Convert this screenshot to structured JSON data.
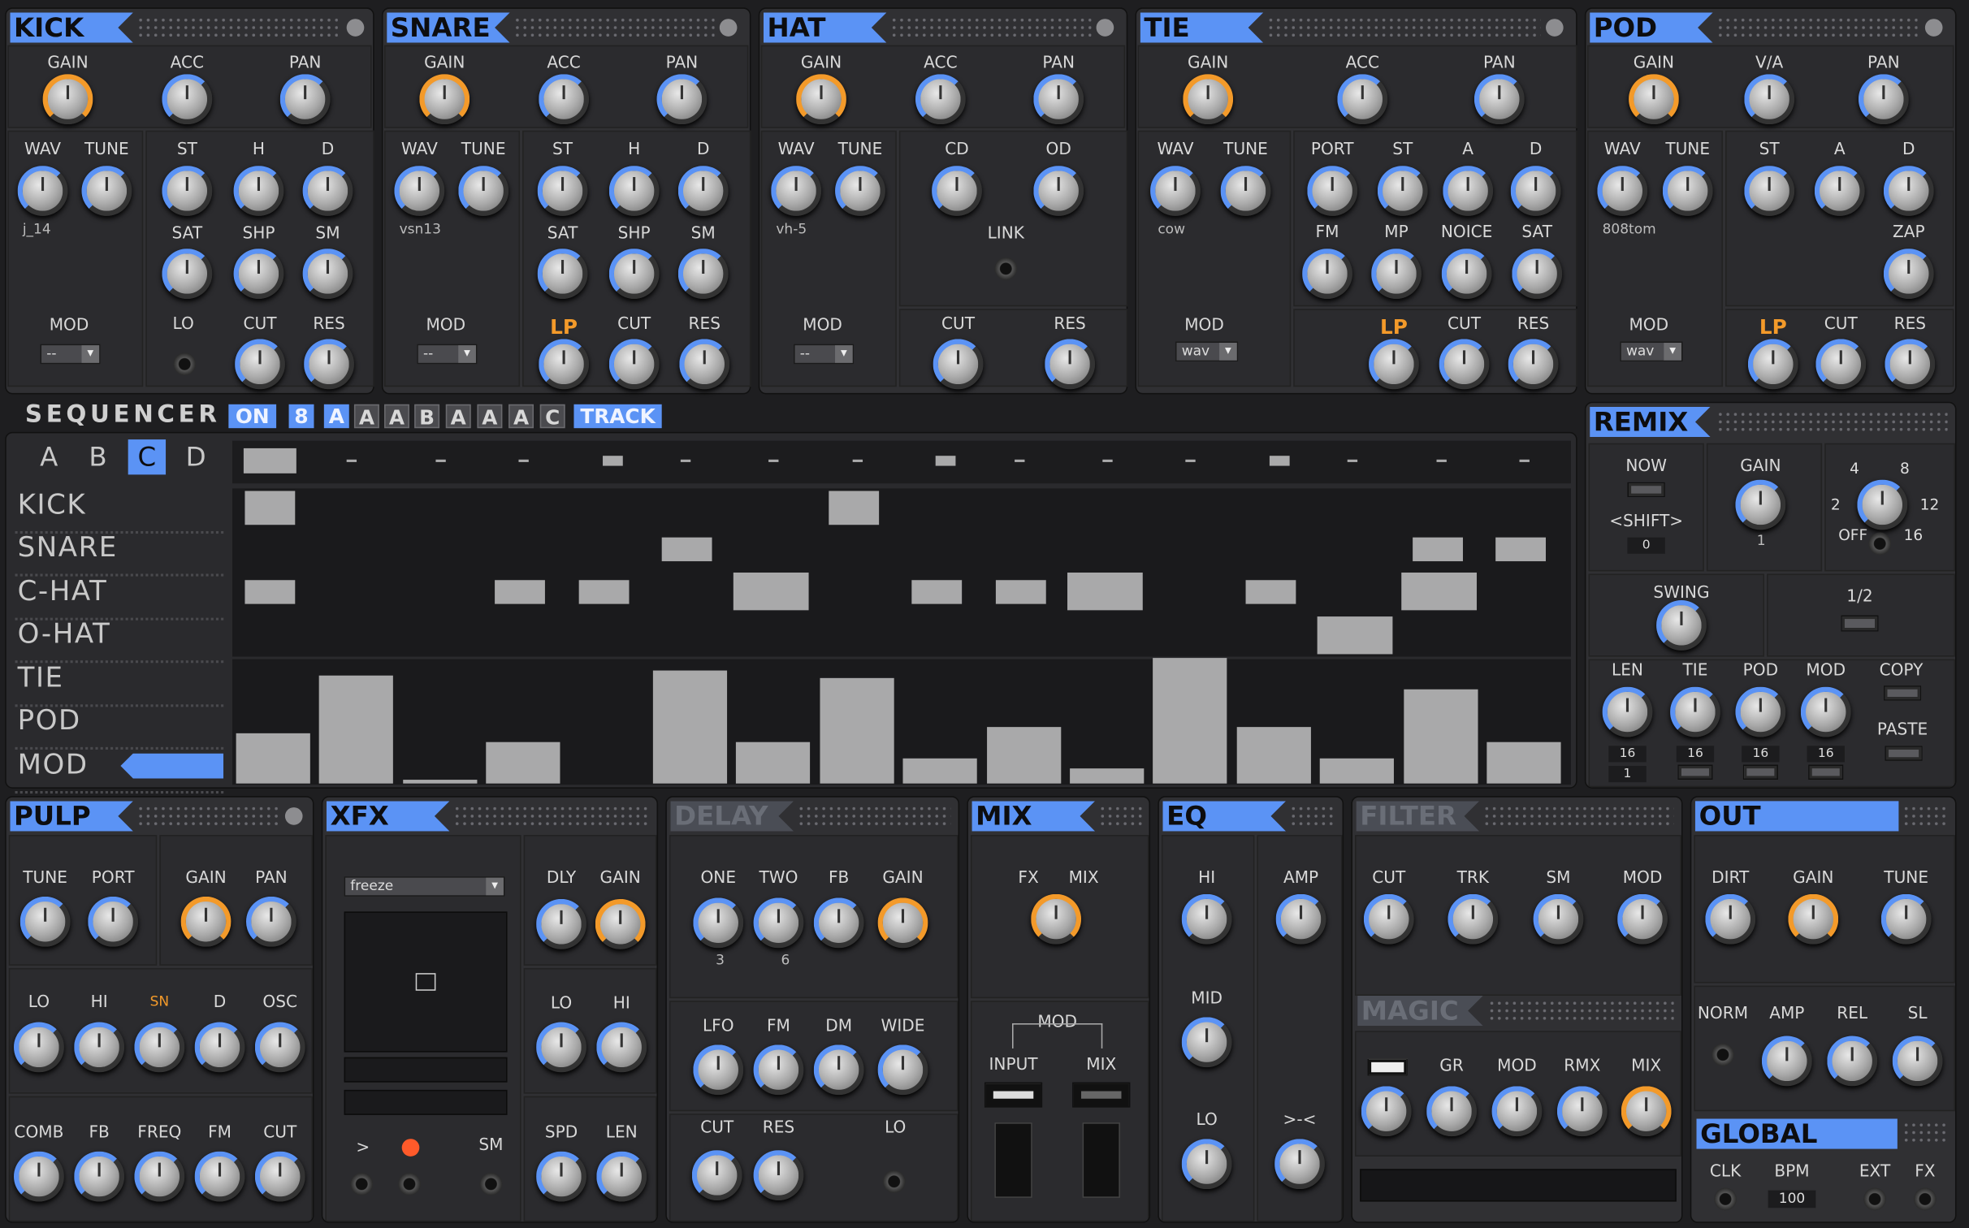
{
  "kick": {
    "title": "KICK",
    "row1": [
      "GAIN",
      "ACC",
      "PAN"
    ],
    "row2": [
      "WAV",
      "TUNE",
      "ST",
      "H",
      "D"
    ],
    "row3": [
      "SAT",
      "SHP",
      "SM"
    ],
    "wav": "j_14",
    "mod": "MOD",
    "mod_value": "--",
    "filter": [
      "LO",
      "CUT",
      "RES"
    ]
  },
  "snare": {
    "title": "SNARE",
    "row1": [
      "GAIN",
      "ACC",
      "PAN"
    ],
    "row2": [
      "WAV",
      "TUNE",
      "ST",
      "H",
      "D"
    ],
    "row3": [
      "SAT",
      "SHP",
      "SM"
    ],
    "wav": "vsn13",
    "mod": "MOD",
    "mod_value": "--",
    "filter": [
      "LP",
      "CUT",
      "RES"
    ]
  },
  "hat": {
    "title": "HAT",
    "row1": [
      "GAIN",
      "ACC",
      "PAN"
    ],
    "row2": [
      "WAV",
      "TUNE",
      "CD",
      "OD"
    ],
    "link": "LINK",
    "wav": "vh-5",
    "mod": "MOD",
    "mod_value": "--",
    "filter": [
      "CUT",
      "RES"
    ]
  },
  "tie": {
    "title": "TIE",
    "row1": [
      "GAIN",
      "ACC",
      "PAN"
    ],
    "row2": [
      "WAV",
      "TUNE",
      "PORT",
      "ST",
      "A",
      "D"
    ],
    "row3": [
      "FM",
      "MP",
      "NOICE",
      "SAT"
    ],
    "wav": "cow",
    "mod": "MOD",
    "mod_value": "wav",
    "filter": [
      "LP",
      "CUT",
      "RES"
    ]
  },
  "pod": {
    "title": "POD",
    "row1": [
      "GAIN",
      "V/A",
      "PAN"
    ],
    "row2": [
      "WAV",
      "TUNE",
      "ST",
      "A",
      "D"
    ],
    "zap": "ZAP",
    "wav": "808tom",
    "mod": "MOD",
    "mod_value": "wav",
    "filter": [
      "LP",
      "CUT",
      "RES"
    ]
  },
  "sequencer": {
    "title": "SEQUENCER",
    "chips": [
      "ON",
      "8",
      "A",
      "A",
      "A",
      "B",
      "A",
      "A",
      "A",
      "C",
      "TRACK"
    ],
    "patterns": [
      "A",
      "B",
      "C",
      "D"
    ],
    "rows": [
      "KICK",
      "SNARE",
      "C-HAT",
      "O-HAT",
      "TIE",
      "POD",
      "MOD"
    ],
    "kick_steps": [
      1,
      0,
      0,
      0,
      0,
      0,
      0,
      1,
      0,
      0,
      0,
      0,
      0,
      0,
      0,
      0
    ],
    "snare_steps": [
      0,
      0,
      0,
      0,
      0,
      1,
      0,
      0,
      0,
      0,
      0,
      0,
      0,
      0,
      1,
      1
    ],
    "chat_steps": [
      1,
      0,
      0,
      1,
      1,
      0,
      2,
      0,
      1,
      1,
      2,
      0,
      1,
      0,
      2,
      0
    ],
    "ohat_steps": [
      0,
      0,
      0,
      0,
      0,
      0,
      0,
      0,
      0,
      0,
      0,
      0,
      0,
      2,
      0,
      0
    ],
    "mod_values": [
      0.47,
      1.0,
      0.04,
      0.38,
      0,
      1.05,
      0.38,
      0.98,
      0.23,
      0.52,
      0.14,
      1.16,
      0.52,
      0.23,
      0.87,
      0.38
    ]
  },
  "remix": {
    "title": "REMIX",
    "now": "NOW",
    "shift": "<SHIFT>",
    "shift_val": "0",
    "gain": "GAIN",
    "gain_val": "1",
    "div": [
      "4",
      "8",
      "2",
      "12",
      "OFF",
      "16"
    ],
    "swing": "SWING",
    "half": "1/2",
    "cols": [
      "LEN",
      "TIE",
      "POD",
      "MOD"
    ],
    "vals": [
      "16",
      "16",
      "16",
      "16"
    ],
    "len_sub": "1",
    "copy": "COPY",
    "paste": "PASTE"
  },
  "pulp": {
    "title": "PULP",
    "row1": [
      "TUNE",
      "PORT",
      "GAIN",
      "PAN"
    ],
    "row2": [
      "LO",
      "HI",
      "SN",
      "D",
      "OSC"
    ],
    "row3": [
      "COMB",
      "FB",
      "FREQ",
      "FM",
      "CUT"
    ]
  },
  "xfx": {
    "title": "XFX",
    "mode": "freeze",
    "row1": [
      "DLY",
      "GAIN"
    ],
    "row2": [
      "LO",
      "HI"
    ],
    "row3": [
      "SPD",
      "LEN"
    ],
    "play": ">",
    "sm": "SM"
  },
  "delay": {
    "title": "DELAY",
    "row1": [
      "ONE",
      "TWO",
      "FB",
      "GAIN"
    ],
    "vals": [
      "3",
      "6"
    ],
    "row2": [
      "LFO",
      "FM",
      "DM",
      "WIDE"
    ],
    "row3": [
      "CUT",
      "RES",
      "LO"
    ]
  },
  "mix": {
    "title": "MIX",
    "row1": [
      "FX",
      "MIX"
    ],
    "mod": "MOD",
    "input": "INPUT",
    "mix2": "MIX"
  },
  "eq": {
    "title": "EQ",
    "labels": [
      "HI",
      "AMP",
      "MID",
      "LO",
      ">-<"
    ]
  },
  "filter": {
    "title": "FILTER",
    "row1": [
      "CUT",
      "TRK",
      "SM",
      "MOD"
    ],
    "magic": "MAGIC",
    "row2": [
      "GR",
      "MOD",
      "RMX",
      "MIX"
    ]
  },
  "out": {
    "title": "OUT",
    "row1": [
      "DIRT",
      "GAIN",
      "TUNE"
    ],
    "row2": [
      "NORM",
      "AMP",
      "REL",
      "SL"
    ]
  },
  "global": {
    "title": "GLOBAL",
    "labels": [
      "CLK",
      "BPM",
      "EXT",
      "FX"
    ],
    "bpm": "100"
  },
  "colors": {
    "accent": "#5b93f5",
    "orange": "#f39a2a",
    "panel": "#303033"
  }
}
